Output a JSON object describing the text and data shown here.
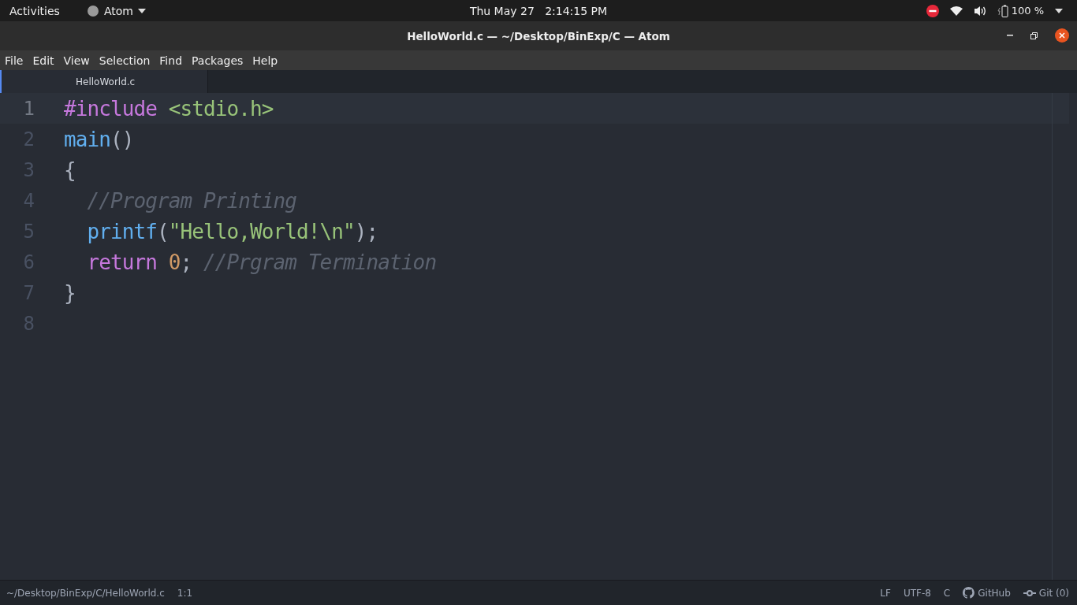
{
  "top_bar": {
    "activities": "Activities",
    "app_menu": "Atom",
    "clock": "Thu May 27   2:14:15 PM",
    "battery": "100 %"
  },
  "window": {
    "title": "HelloWorld.c — ~/Desktop/BinExp/C — Atom"
  },
  "menu": [
    "File",
    "Edit",
    "View",
    "Selection",
    "Find",
    "Packages",
    "Help"
  ],
  "tabs": [
    {
      "label": "HelloWorld.c",
      "selected": true
    }
  ],
  "editor": {
    "lines": [
      {
        "number": "1",
        "current": true,
        "tokens": [
          {
            "kind": "keyword",
            "text": "#include"
          },
          {
            "kind": "string",
            "text": " <stdio.h>"
          }
        ]
      },
      {
        "number": "2",
        "current": false,
        "tokens": [
          {
            "kind": "func",
            "text": "main"
          },
          {
            "kind": "plain",
            "text": "()"
          }
        ]
      },
      {
        "number": "3",
        "current": false,
        "tokens": [
          {
            "kind": "plain",
            "text": "{"
          }
        ]
      },
      {
        "number": "4",
        "current": false,
        "tokens": [
          {
            "kind": "comment",
            "text": "  //Program Printing"
          }
        ]
      },
      {
        "number": "5",
        "current": false,
        "tokens": [
          {
            "kind": "func",
            "text": "  printf"
          },
          {
            "kind": "plain",
            "text": "("
          },
          {
            "kind": "string",
            "text": "\"Hello,World!\\n\""
          },
          {
            "kind": "plain",
            "text": ");"
          }
        ]
      },
      {
        "number": "6",
        "current": false,
        "tokens": [
          {
            "kind": "keyword",
            "text": "  return"
          },
          {
            "kind": "number",
            "text": " 0"
          },
          {
            "kind": "plain",
            "text": "; "
          },
          {
            "kind": "comment",
            "text": "//Prgram Termination"
          }
        ]
      },
      {
        "number": "7",
        "current": false,
        "tokens": [
          {
            "kind": "plain",
            "text": "}"
          }
        ]
      },
      {
        "number": "8",
        "current": false
      }
    ]
  },
  "status_bar": {
    "path": "~/Desktop/BinExp/C/HelloWorld.c",
    "cursor": "1:1",
    "line_ending": "LF",
    "encoding": "UTF-8",
    "grammar": "C",
    "github": "GitHub",
    "git": "Git (0)"
  }
}
